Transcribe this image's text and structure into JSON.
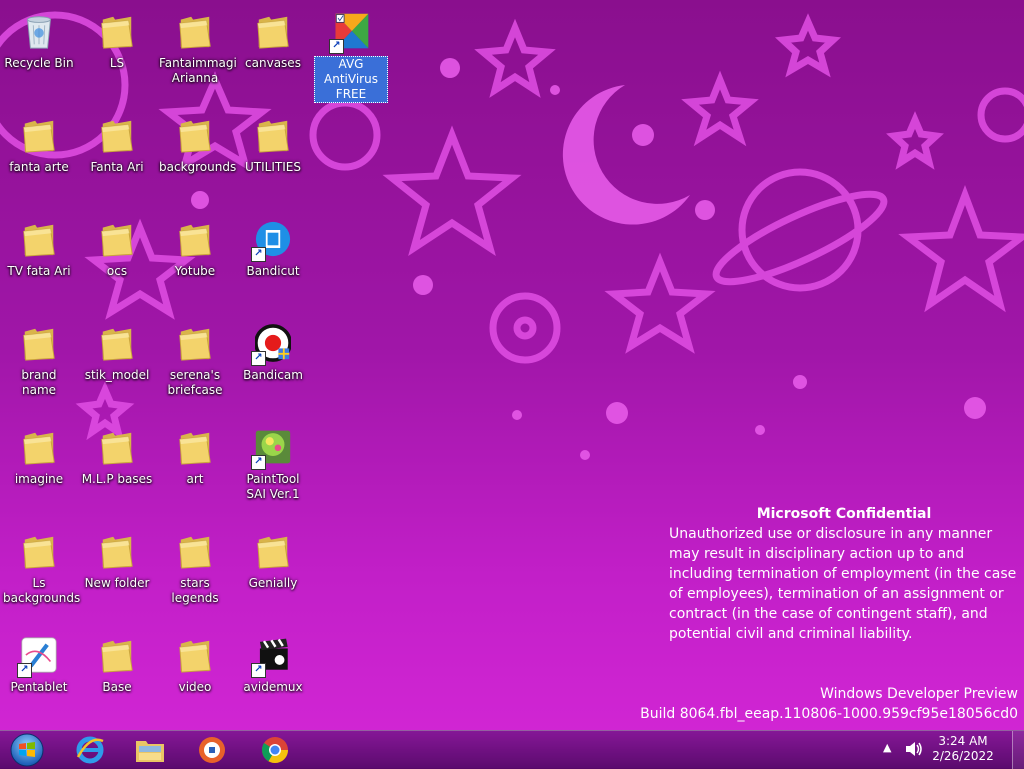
{
  "desktop_icons": [
    {
      "label": "Recycle Bin",
      "kind": "recycle-bin",
      "col": 0,
      "row": 0
    },
    {
      "label": "LS",
      "kind": "folder",
      "col": 1,
      "row": 0
    },
    {
      "label": "Fantaimmagi Arianna",
      "kind": "folder",
      "col": 2,
      "row": 0
    },
    {
      "label": "canvases",
      "kind": "folder",
      "col": 3,
      "row": 0
    },
    {
      "label": "AVG AntiVirus FREE",
      "kind": "avg",
      "col": 4,
      "row": 0,
      "selected": true
    },
    {
      "label": "fanta arte",
      "kind": "folder",
      "col": 0,
      "row": 1
    },
    {
      "label": "Fanta Ari",
      "kind": "folder",
      "col": 1,
      "row": 1
    },
    {
      "label": "backgrounds",
      "kind": "folder",
      "col": 2,
      "row": 1
    },
    {
      "label": "UTILITIES",
      "kind": "folder",
      "col": 3,
      "row": 1
    },
    {
      "label": "TV fata Ari",
      "kind": "folder",
      "col": 0,
      "row": 2
    },
    {
      "label": "ocs",
      "kind": "folder",
      "col": 1,
      "row": 2
    },
    {
      "label": "Yotube",
      "kind": "folder",
      "col": 2,
      "row": 2
    },
    {
      "label": "Bandicut",
      "kind": "bandicut",
      "col": 3,
      "row": 2
    },
    {
      "label": "brand name",
      "kind": "folder",
      "col": 0,
      "row": 3
    },
    {
      "label": "stik_model",
      "kind": "folder",
      "col": 1,
      "row": 3
    },
    {
      "label": "serena's briefcase",
      "kind": "folder",
      "col": 2,
      "row": 3
    },
    {
      "label": "Bandicam",
      "kind": "bandicam",
      "col": 3,
      "row": 3
    },
    {
      "label": "imagine",
      "kind": "folder",
      "col": 0,
      "row": 4
    },
    {
      "label": "M.L.P bases",
      "kind": "folder",
      "col": 1,
      "row": 4
    },
    {
      "label": "art",
      "kind": "folder",
      "col": 2,
      "row": 4
    },
    {
      "label": "PaintTool SAI Ver.1",
      "kind": "painttool",
      "col": 3,
      "row": 4
    },
    {
      "label": "Ls backgrounds",
      "kind": "folder",
      "col": 0,
      "row": 5
    },
    {
      "label": "New folder",
      "kind": "folder",
      "col": 1,
      "row": 5
    },
    {
      "label": "stars legends",
      "kind": "folder",
      "col": 2,
      "row": 5
    },
    {
      "label": "Genially",
      "kind": "folder",
      "col": 3,
      "row": 5
    },
    {
      "label": "Pentablet",
      "kind": "pentablet",
      "col": 0,
      "row": 6
    },
    {
      "label": "Base",
      "kind": "folder",
      "col": 1,
      "row": 6
    },
    {
      "label": "video",
      "kind": "folder",
      "col": 2,
      "row": 6
    },
    {
      "label": "avidemux",
      "kind": "avidemux",
      "col": 3,
      "row": 6
    }
  ],
  "watermark": {
    "title": "Microsoft Confidential",
    "body": "Unauthorized use or disclosure in any manner may result in disciplinary action up to and including termination of employment (in the case of employees), termination of an assignment or contract (in the case of contingent staff), and potential civil and criminal liability.",
    "edition": "Windows Developer Preview",
    "build": "Build 8064.fbl_eeap.110806-1000.959cf95e18056cd0"
  },
  "taskbar": {
    "pinned": [
      {
        "name": "internet-explorer",
        "icon": "ie-icon"
      },
      {
        "name": "file-explorer",
        "icon": "explorer-icon"
      },
      {
        "name": "browser",
        "icon": "firefox-icon"
      },
      {
        "name": "chrome",
        "icon": "chrome-icon"
      }
    ],
    "clock": {
      "time": "3:24 AM",
      "date": "2/26/2022"
    }
  },
  "colors": {
    "wallpaper_top": "#8a0f8e",
    "wallpaper_bottom": "#d427d6",
    "wallpaper_shapes": "#e650e8",
    "selection": "#3a6fd8",
    "folder": "#f3d36b"
  }
}
